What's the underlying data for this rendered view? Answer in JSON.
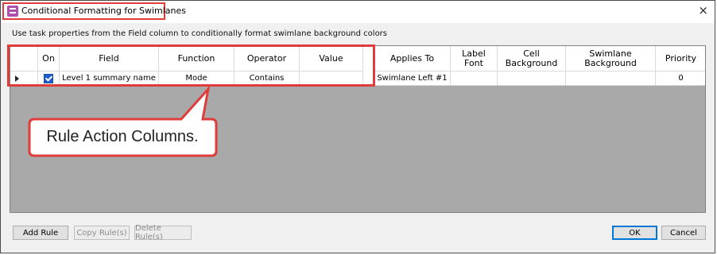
{
  "window": {
    "title": "Conditional Formatting for Swimlanes",
    "close_glyph": "×",
    "description": "Use task properties from the Field column to conditionally format swimlane background colors"
  },
  "grid": {
    "columns": [
      "",
      "On",
      "Field",
      "Function",
      "Operator",
      "Value",
      "Applies To",
      "Label\nFont",
      "Cell\nBackground",
      "Swimlane\nBackground",
      "Priority"
    ],
    "rows": [
      {
        "on": true,
        "field": "Level 1 summary name",
        "function": "Mode",
        "operator": "Contains",
        "value": "",
        "applies_to": "Swimlane Left #1",
        "label_font": "",
        "cell_background": "",
        "swimlane_background": "",
        "priority": "0"
      }
    ]
  },
  "callout": {
    "text": "Rule Action Columns."
  },
  "buttons": {
    "add_rule": "Add Rule",
    "copy_rules": "Copy Rule(s)",
    "delete_rules": "Delete Rule(s)",
    "ok": "OK",
    "cancel": "Cancel"
  },
  "colors": {
    "highlight": "#e03c3c",
    "grid_background": "#a9a9a9",
    "checkbox": "#1e5fd0",
    "app_icon": "#b04fb0"
  },
  "icons": {
    "app": "swimlane-format-icon",
    "close": "close-icon",
    "row_selector": "row-pointer-icon"
  }
}
